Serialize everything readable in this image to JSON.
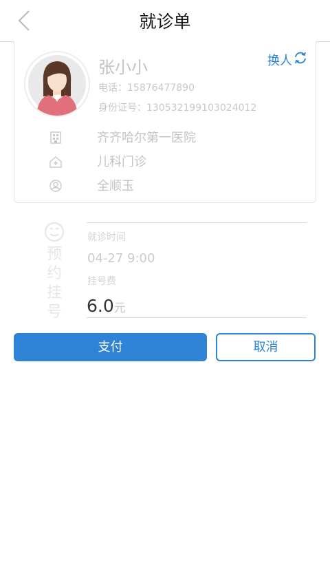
{
  "header": {
    "title": "就诊单",
    "back_icon": "chevron-left-icon"
  },
  "patient": {
    "name": "张小小",
    "switch_label": "换人",
    "phone": "电话：15876477890",
    "id_number": "身份证号：130532199103024012",
    "hospital": "齐齐哈尔第一医院",
    "department": "儿科门诊",
    "doctor": "全顺玉"
  },
  "appointment": {
    "stamp": [
      "预",
      "约",
      "挂",
      "号"
    ],
    "time_label": "就诊时间",
    "time_value": "04-27 9:00",
    "fee_label": "挂号费",
    "fee_amount": "6.0",
    "fee_unit": "元"
  },
  "actions": {
    "pay": "支付",
    "cancel": "取消"
  },
  "colors": {
    "accent": "#2f83d6",
    "muted_text": "#c4c4c4"
  }
}
